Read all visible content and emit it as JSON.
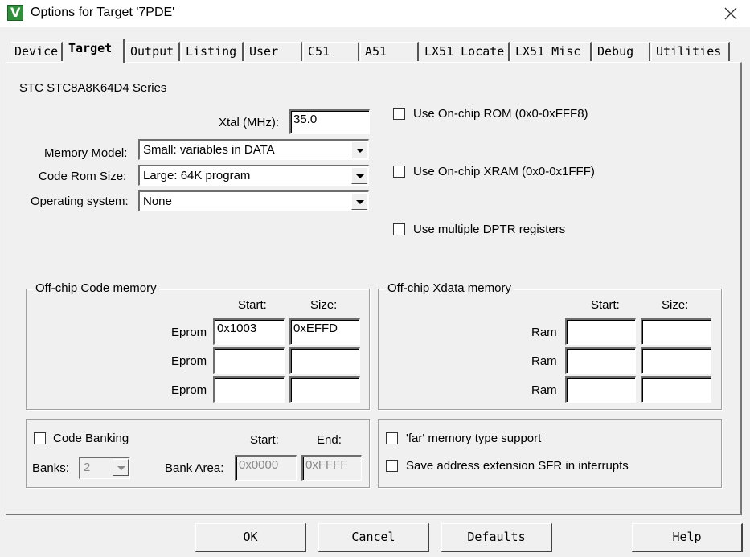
{
  "window": {
    "title": "Options for Target '7PDE'"
  },
  "tabs": [
    {
      "label": "Device"
    },
    {
      "label": "Target"
    },
    {
      "label": "Output"
    },
    {
      "label": "Listing"
    },
    {
      "label": "User"
    },
    {
      "label": "C51"
    },
    {
      "label": "A51"
    },
    {
      "label": "LX51 Locate"
    },
    {
      "label": "LX51 Misc"
    },
    {
      "label": "Debug"
    },
    {
      "label": "Utilities"
    }
  ],
  "active_tab": "Target",
  "target": {
    "device_series": "STC STC8A8K64D4 Series",
    "xtal_label": "Xtal (MHz):",
    "xtal_value": "35.0",
    "memory_model_label": "Memory Model:",
    "memory_model_value": "Small: variables in DATA",
    "code_rom_size_label": "Code Rom Size:",
    "code_rom_size_value": "Large: 64K program",
    "operating_system_label": "Operating system:",
    "operating_system_value": "None",
    "use_onchip_rom_label": "Use On-chip ROM (0x0-0xFFF8)",
    "use_onchip_xram_label": "Use On-chip XRAM (0x0-0x1FFF)",
    "use_multiple_dptr_label": "Use multiple DPTR registers"
  },
  "offchip_code": {
    "title": "Off-chip Code memory",
    "start_header": "Start:",
    "size_header": "Size:",
    "rows": [
      {
        "label": "Eprom",
        "start": "0x1003",
        "size": "0xEFFD"
      },
      {
        "label": "Eprom",
        "start": "",
        "size": ""
      },
      {
        "label": "Eprom",
        "start": "",
        "size": ""
      }
    ]
  },
  "offchip_xdata": {
    "title": "Off-chip Xdata memory",
    "start_header": "Start:",
    "size_header": "Size:",
    "rows": [
      {
        "label": "Ram",
        "start": "",
        "size": ""
      },
      {
        "label": "Ram",
        "start": "",
        "size": ""
      },
      {
        "label": "Ram",
        "start": "",
        "size": ""
      }
    ]
  },
  "banking": {
    "code_banking_label": "Code Banking",
    "banks_label": "Banks:",
    "banks_value": "2",
    "bank_area_label": "Bank Area:",
    "start_header": "Start:",
    "end_header": "End:",
    "start_value": "0x0000",
    "end_value": "0xFFFF"
  },
  "options": {
    "far_memory_label": "'far' memory type support",
    "save_address_label": "Save address extension SFR in interrupts"
  },
  "buttons": {
    "ok": "OK",
    "cancel": "Cancel",
    "defaults": "Defaults",
    "help": "Help"
  }
}
